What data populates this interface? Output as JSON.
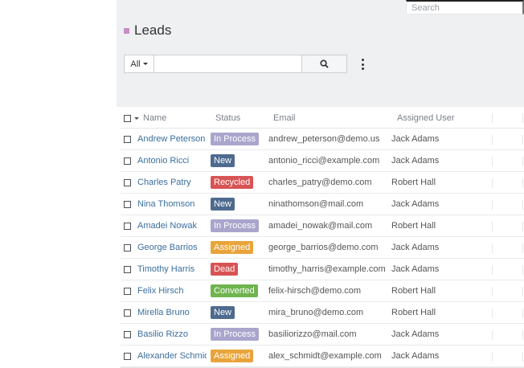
{
  "global_search": {
    "placeholder": "Search"
  },
  "header": {
    "title": "Leads",
    "title_marker_color": "#c98fc5"
  },
  "filter": {
    "all_label": "All",
    "search_value": ""
  },
  "table": {
    "columns": [
      "Name",
      "Status",
      "Email",
      "Assigned User"
    ],
    "rows": [
      {
        "name": "Andrew Peterson",
        "status": "In Process",
        "status_color": "#a9a5cc",
        "email": "andrew_peterson@demo.us",
        "user": "Jack Adams"
      },
      {
        "name": "Antonio Ricci",
        "status": "New",
        "status_color": "#4e6b8f",
        "email": "antonio_ricci@example.com",
        "user": "Jack Adams"
      },
      {
        "name": "Charles Patry",
        "status": "Recycled",
        "status_color": "#d85454",
        "email": "charles_patry@demo.com",
        "user": "Robert Hall"
      },
      {
        "name": "Nina Thomson",
        "status": "New",
        "status_color": "#4e6b8f",
        "email": "ninathomson@mail.com",
        "user": "Jack Adams"
      },
      {
        "name": "Amadei Nowak",
        "status": "In Process",
        "status_color": "#a9a5cc",
        "email": "amadei_nowak@mail.com",
        "user": "Robert Hall"
      },
      {
        "name": "George Barrios",
        "status": "Assigned",
        "status_color": "#e8a43a",
        "email": "george_barrios@demo.com",
        "user": "Jack Adams"
      },
      {
        "name": "Timothy Harris",
        "status": "Dead",
        "status_color": "#d85454",
        "email": "timothy_harris@example.com",
        "user": "Jack Adams"
      },
      {
        "name": "Felix Hirsch",
        "status": "Converted",
        "status_color": "#6fb44f",
        "email": "felix-hirsch@demo.com",
        "user": "Robert Hall"
      },
      {
        "name": "Mirella Bruno",
        "status": "New",
        "status_color": "#4e6b8f",
        "email": "mira_bruno@demo.com",
        "user": "Robert Hall"
      },
      {
        "name": "Basilio Rizzo",
        "status": "In Process",
        "status_color": "#a9a5cc",
        "email": "basiliorizzo@mail.com",
        "user": "Jack Adams"
      },
      {
        "name": "Alexander Schmidt",
        "status": "Assigned",
        "status_color": "#e8a43a",
        "email": "alex_schmidt@example.com",
        "user": "Jack Adams"
      }
    ]
  }
}
